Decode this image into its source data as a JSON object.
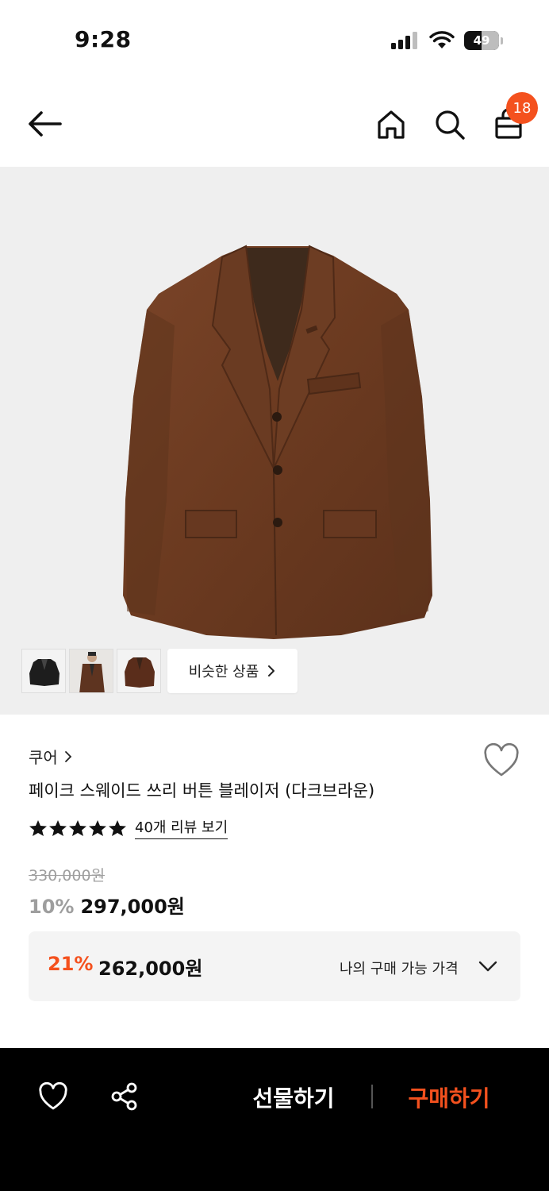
{
  "status_bar": {
    "time": "9:28",
    "battery": "49",
    "icons": [
      "signal-icon",
      "wifi-icon",
      "battery-icon"
    ]
  },
  "nav": {
    "icons": [
      "arrow-left-icon",
      "home-icon",
      "search-icon",
      "shopping-bag-icon"
    ],
    "cart_count": "18"
  },
  "gallery": {
    "thumbnails": [
      "jacket-black-thumbnail",
      "model-wearing-thumbnail",
      "jacket-brown-thumbnail"
    ],
    "similar_label": "비슷한 상품",
    "similar_icon": "chevron-right-icon"
  },
  "product": {
    "brand": "쿠어",
    "name": "페이크 스웨이드 쓰리 버튼 블레이저 (다크브라운)",
    "rating_stars": 5,
    "review_link": "40개 리뷰 보기",
    "original_price": "330,000원",
    "discount": "10%",
    "price": "297,000원"
  },
  "my_price": {
    "discount": "21%",
    "price": "262,000원",
    "label": "나의 구매 가능 가격"
  },
  "bottom_bar": {
    "gift_label": "선물하기",
    "buy_label": "구매하기"
  },
  "colors": {
    "accent": "#f4511e",
    "image_bg": "#efefef",
    "jacket": "#6b3b22"
  }
}
